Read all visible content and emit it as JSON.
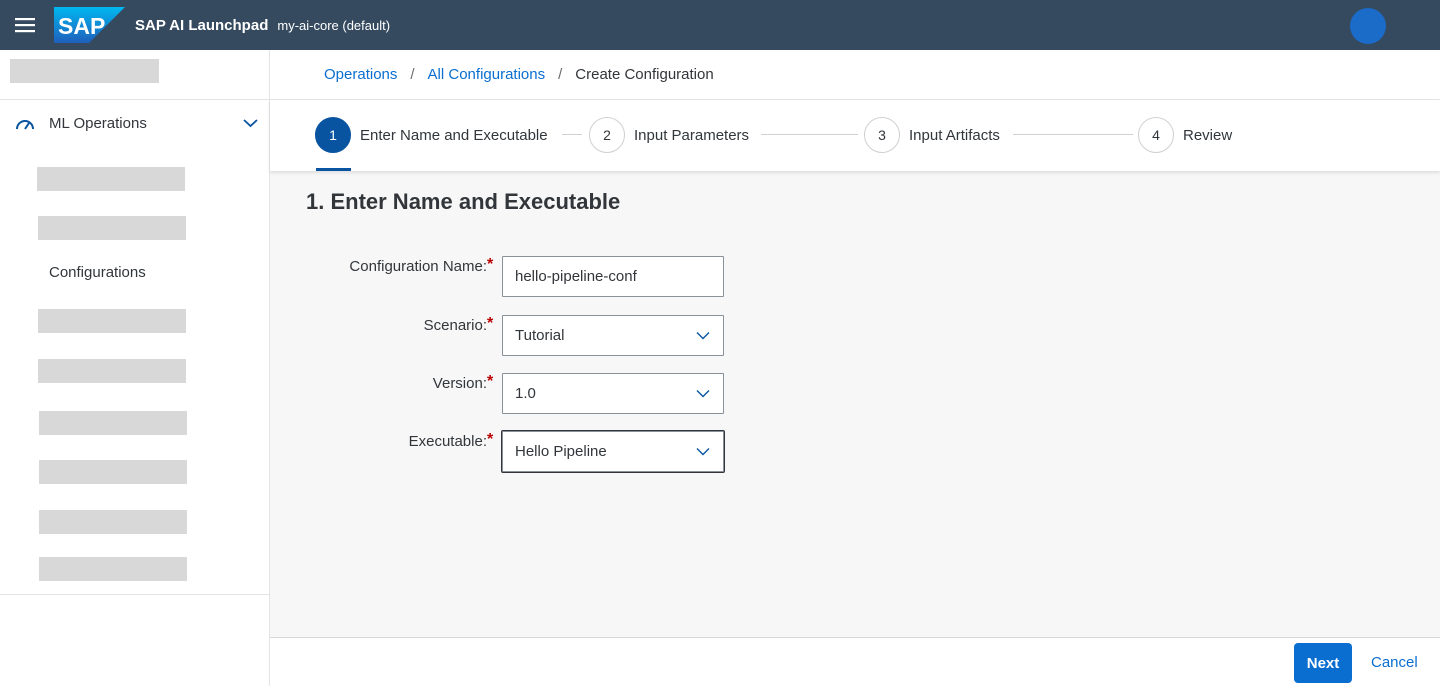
{
  "shell": {
    "brand": "SAP",
    "product_title": "SAP AI Launchpad",
    "tenant": "my-ai-core (default)",
    "menu_icon": "hamburger-icon",
    "avatar_color": "#1b6bc9"
  },
  "sidebar": {
    "group_label": "ML Operations",
    "group_icon": "gauge-icon",
    "active_item": "Configurations"
  },
  "breadcrumb": {
    "items": [
      "Operations",
      "All Configurations"
    ],
    "current": "Create Configuration",
    "separator": "/"
  },
  "wizard": {
    "steps": [
      {
        "num": "1",
        "label": "Enter Name and Executable"
      },
      {
        "num": "2",
        "label": "Input Parameters"
      },
      {
        "num": "3",
        "label": "Input Artifacts"
      },
      {
        "num": "4",
        "label": "Review"
      }
    ],
    "active_step": 1
  },
  "form": {
    "heading": "1. Enter Name and Executable",
    "required_marker": "*",
    "fields": [
      {
        "label": "Configuration Name:",
        "value": "hello-pipeline-conf",
        "type": "input"
      },
      {
        "label": "Scenario:",
        "value": "Tutorial",
        "type": "select"
      },
      {
        "label": "Version:",
        "value": "1.0",
        "type": "select"
      },
      {
        "label": "Executable:",
        "value": "Hello Pipeline",
        "type": "select"
      }
    ]
  },
  "footer": {
    "next_label": "Next",
    "cancel_label": "Cancel"
  },
  "colors": {
    "shell_bg": "#354a5f",
    "accent": "#0a6ed1",
    "active_step": "#0854a0",
    "required": "#bb0000"
  }
}
